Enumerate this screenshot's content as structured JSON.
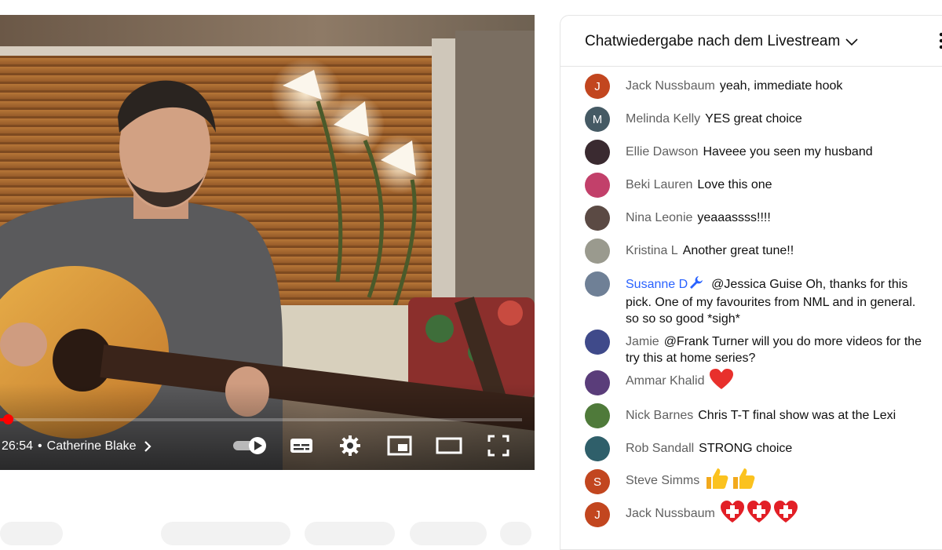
{
  "player": {
    "time": "26:54",
    "channel": "Catherine Blake",
    "progress_fraction": 0.015
  },
  "chat": {
    "title": "Chatwiedergabe nach dem Livestream",
    "messages": [
      {
        "author": "Jack Nussbaum",
        "text": "yeah, immediate hook",
        "avatar_letter": "J",
        "avatar_color": "#c2461f"
      },
      {
        "author": "Melinda Kelly",
        "text": "YES great choice",
        "avatar_letter": "M",
        "avatar_color": "#455a64"
      },
      {
        "author": "Ellie Dawson",
        "text": "Haveee you seen my husband",
        "avatar_letter": "",
        "avatar_color": "#3a2a30"
      },
      {
        "author": "Beki Lauren",
        "text": "Love this one",
        "avatar_letter": "",
        "avatar_color": "#c2406a"
      },
      {
        "author": "Nina Leonie",
        "text": "yeaaassss!!!!",
        "avatar_letter": "",
        "avatar_color": "#5b4a44"
      },
      {
        "author": "Kristina L",
        "text": "Another great tune!!",
        "avatar_letter": "",
        "avatar_color": "#9a9a8e"
      },
      {
        "author": "Susanne D",
        "text": "@Jessica Guise Oh, thanks for this pick. One of my favourites from NML and in general. so so so good *sigh*",
        "avatar_letter": "",
        "avatar_color": "#6f8096",
        "moderator": true
      },
      {
        "author": "Jamie",
        "text": "@Frank Turner will you do more videos for the try this at home series?",
        "avatar_letter": "",
        "avatar_color": "#3f4a8a"
      },
      {
        "author": "Ammar Khalid",
        "text": "",
        "avatar_letter": "",
        "avatar_color": "#5a3d7a",
        "emoji": [
          "red-heart"
        ]
      },
      {
        "author": "Nick Barnes",
        "text": "Chris T-T final show was at the Lexi",
        "avatar_letter": "",
        "avatar_color": "#4f7a3a"
      },
      {
        "author": "Rob Sandall",
        "text": "STRONG choice",
        "avatar_letter": "",
        "avatar_color": "#2f5f6a"
      },
      {
        "author": "Steve Simms",
        "text": "",
        "avatar_letter": "S",
        "avatar_color": "#c2461f",
        "emoji": [
          "thumbs-up",
          "thumbs-up"
        ]
      },
      {
        "author": "Jack Nussbaum",
        "text": "",
        "avatar_letter": "J",
        "avatar_color": "#c2461f",
        "emoji": [
          "hospital-cross",
          "hospital-cross",
          "hospital-cross"
        ]
      }
    ]
  },
  "colors": {
    "accent_red": "#ff0000",
    "moderator_blue": "#2962ff",
    "author_gray": "#606060"
  }
}
